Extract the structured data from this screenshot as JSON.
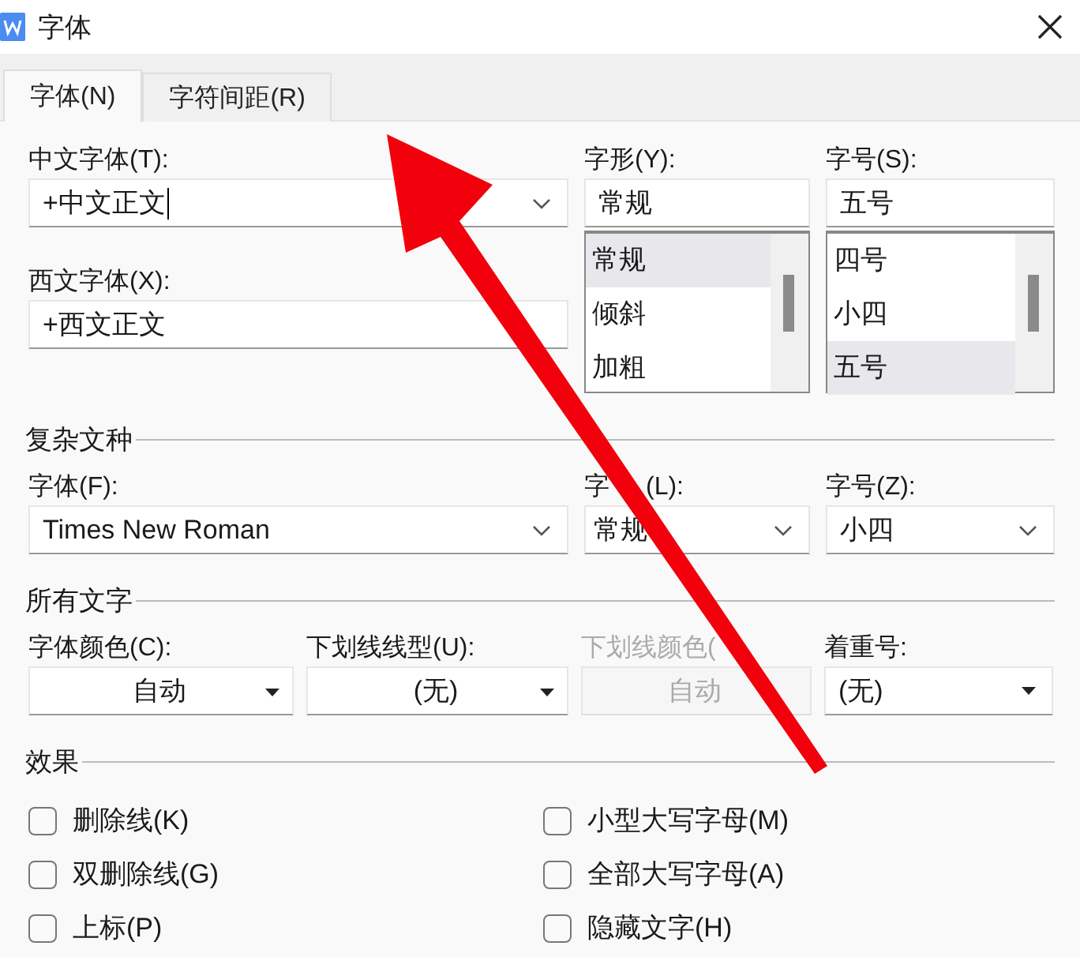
{
  "window": {
    "title": "字体"
  },
  "tabs": [
    {
      "label": "字体(N)",
      "selected": true
    },
    {
      "label": "字符间距(R)",
      "selected": false
    }
  ],
  "chinese_font": {
    "label": "中文字体(T):",
    "value": "+中文正文"
  },
  "style": {
    "label": "字形(Y):",
    "value": "常规",
    "options": [
      {
        "label": "常规",
        "selected": true
      },
      {
        "label": "倾斜",
        "selected": false
      },
      {
        "label": "加粗",
        "selected": false
      }
    ]
  },
  "size": {
    "label": "字号(S):",
    "value": "五号",
    "options": [
      {
        "label": "四号",
        "selected": false
      },
      {
        "label": "小四",
        "selected": false
      },
      {
        "label": "五号",
        "selected": true
      }
    ]
  },
  "western_font": {
    "label": "西文字体(X):",
    "value": "+西文正文"
  },
  "complex_script": {
    "title": "复杂文种",
    "fields": [
      {
        "label": "字体(F):",
        "value": "Times New Roman"
      },
      {
        "label": "字",
        "label_tail": "(L):",
        "value": "常规"
      },
      {
        "label": "字号(Z):",
        "value": "小四"
      }
    ]
  },
  "all_text": {
    "title": "所有文字",
    "fields": [
      {
        "label": "字体颜色(C):",
        "value": "自动",
        "disabled": false
      },
      {
        "label": "下划线线型(U):",
        "value": "(无)",
        "disabled": false
      },
      {
        "label": "下划线颜色(",
        "value": "自动",
        "disabled": true
      },
      {
        "label": "着重号:",
        "value": "(无)",
        "disabled": false
      }
    ]
  },
  "effects": {
    "title": "效果",
    "options": [
      {
        "label": "删除线(K)",
        "checked": false
      },
      {
        "label": "小型大写字母(M)",
        "checked": false
      },
      {
        "label": "双删除线(G)",
        "checked": false
      },
      {
        "label": "全部大写字母(A)",
        "checked": false
      },
      {
        "label": "上标(P)",
        "checked": false
      },
      {
        "label": "隐藏文字(H)",
        "checked": false
      }
    ]
  }
}
